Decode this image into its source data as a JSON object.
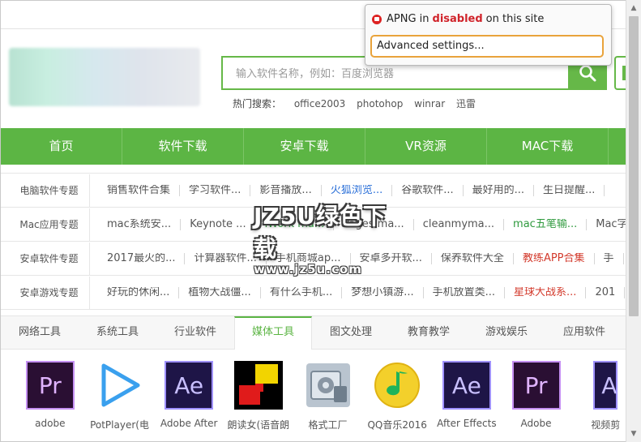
{
  "popup": {
    "prefix": "APNG in",
    "status": "disabled",
    "suffix": "on this site",
    "button": "Advanced settings...",
    "icon": "apng-icon"
  },
  "search": {
    "placeholder": "输入软件名称，例如：百度浏览器",
    "hot_label": "热门搜索：",
    "hot_items": [
      "office2003",
      "photohop",
      "winrar",
      "迅雷"
    ]
  },
  "nav": [
    "首页",
    "软件下载",
    "安卓下载",
    "VR资源",
    "MAC下载"
  ],
  "topics": [
    {
      "label": "电脑软件专题",
      "items": [
        {
          "text": "销售软件合集",
          "color": ""
        },
        {
          "text": "学习软件...",
          "color": ""
        },
        {
          "text": "影音播放...",
          "color": ""
        },
        {
          "text": "火狐浏览...",
          "color": "blue"
        },
        {
          "text": "谷歌软件...",
          "color": ""
        },
        {
          "text": "最好用的...",
          "color": ""
        },
        {
          "text": "生日提醒...",
          "color": ""
        }
      ]
    },
    {
      "label": "Mac应用专题",
      "items": [
        {
          "text": "mac系统安...",
          "color": ""
        },
        {
          "text": "Keynote ...",
          "color": ""
        },
        {
          "text": "iWork ma...",
          "color": "green"
        },
        {
          "text": "Pages ma...",
          "color": ""
        },
        {
          "text": "cleanmyma...",
          "color": ""
        },
        {
          "text": "mac五笔输...",
          "color": "green"
        },
        {
          "text": "Mac字",
          "color": ""
        }
      ]
    },
    {
      "label": "安卓软件专题",
      "items": [
        {
          "text": "2017最火的...",
          "color": ""
        },
        {
          "text": "计算器软件...",
          "color": ""
        },
        {
          "text": "手机商城ap...",
          "color": ""
        },
        {
          "text": "安卓多开软...",
          "color": ""
        },
        {
          "text": "保养软件大全",
          "color": ""
        },
        {
          "text": "教练APP合集",
          "color": "red"
        },
        {
          "text": "手",
          "color": ""
        }
      ]
    },
    {
      "label": "安卓游戏专题",
      "items": [
        {
          "text": "好玩的休闲...",
          "color": ""
        },
        {
          "text": "植物大战僵...",
          "color": ""
        },
        {
          "text": "有什么手机...",
          "color": ""
        },
        {
          "text": "梦想小镇游...",
          "color": ""
        },
        {
          "text": "手机放置类...",
          "color": ""
        },
        {
          "text": "星球大战系...",
          "color": "red"
        },
        {
          "text": "201",
          "color": ""
        }
      ]
    }
  ],
  "tabs": [
    "网络工具",
    "系统工具",
    "行业软件",
    "媒体工具",
    "图文处理",
    "教育教学",
    "游戏娱乐",
    "应用软件"
  ],
  "active_tab": "媒体工具",
  "apps": [
    {
      "name": "adobe",
      "icon": "premiere-icon",
      "glyph": "Pr"
    },
    {
      "name": "PotPlayer(电",
      "icon": "potplayer-icon",
      "glyph": ""
    },
    {
      "name": "Adobe After",
      "icon": "after-effects-icon",
      "glyph": "Ae"
    },
    {
      "name": "朗读女(语音朗",
      "icon": "langdunv-icon",
      "glyph": ""
    },
    {
      "name": "格式工厂",
      "icon": "format-factory-icon",
      "glyph": ""
    },
    {
      "name": "QQ音乐2016",
      "icon": "qq-music-icon",
      "glyph": ""
    },
    {
      "name": "After Effects",
      "icon": "after-effects-icon",
      "glyph": "Ae"
    },
    {
      "name": "Adobe",
      "icon": "premiere-icon",
      "glyph": "Pr"
    },
    {
      "name": "视频剪",
      "icon": "video-editor-icon",
      "glyph": "A"
    }
  ],
  "watermark": {
    "top": "JZ5U绿色下载",
    "bottom": "www.jz5u.com"
  },
  "colors": {
    "brand_green": "#5cb544",
    "disabled_red": "#d0232a",
    "focus_orange": "#e9a33b"
  }
}
